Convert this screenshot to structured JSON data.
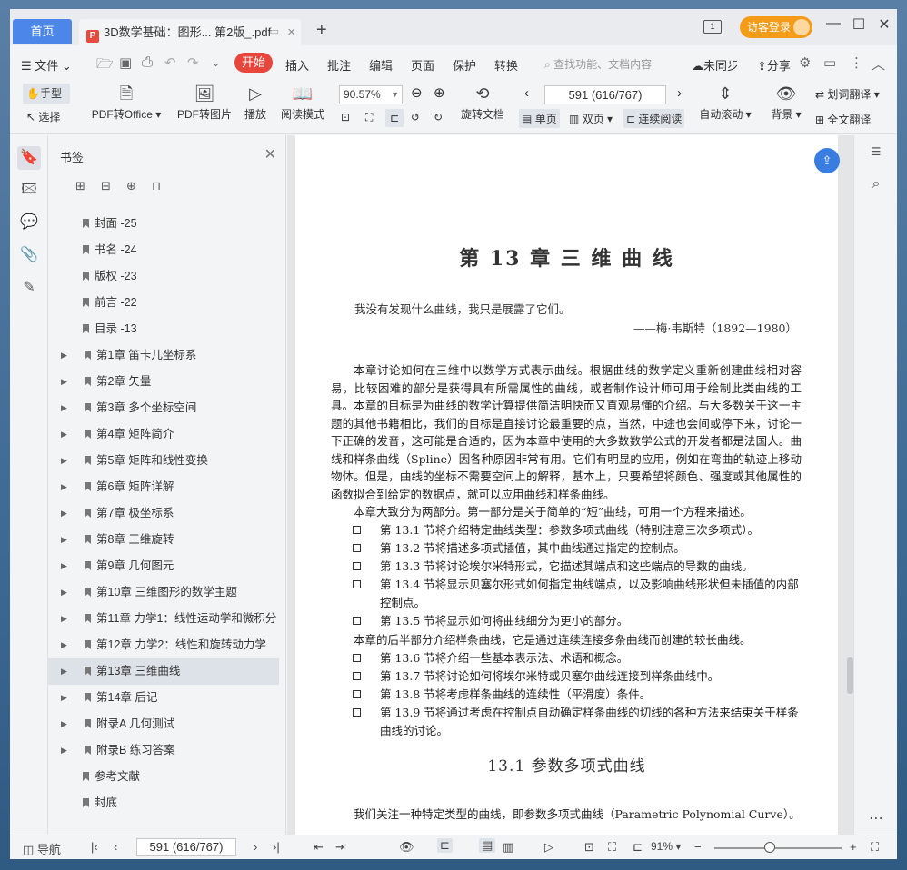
{
  "tabs": {
    "home": "首页",
    "doc_title": "3D数学基础：图形... 第2版_.pdf"
  },
  "titlebar": {
    "login": "访客登录"
  },
  "menu": {
    "file": "文件",
    "start": "开始",
    "items": [
      "插入",
      "批注",
      "编辑",
      "页面",
      "保护",
      "转换"
    ],
    "search_placeholder": "查找功能、文档内容",
    "sync": "未同步",
    "share": "分享"
  },
  "ribbon": {
    "hand": "手型",
    "select": "选择",
    "pdf_to_office": "PDF转Office",
    "pdf_to_image": "PDF转图片",
    "play": "播放",
    "read_mode": "阅读模式",
    "zoom": "90.57%",
    "rotate_doc": "旋转文档",
    "page_value": "591 (616/767)",
    "single": "单页",
    "double": "双页",
    "continuous": "连续阅读",
    "autoscroll": "自动滚动",
    "background": "背景",
    "word_translate": "划词翻译",
    "full_translate": "全文翻译"
  },
  "bookmarks": {
    "title": "书签",
    "items": [
      {
        "label": "封面 -25",
        "expandable": false
      },
      {
        "label": "书名 -24",
        "expandable": false
      },
      {
        "label": "版权 -23",
        "expandable": false
      },
      {
        "label": "前言 -22",
        "expandable": false
      },
      {
        "label": "目录 -13",
        "expandable": false
      },
      {
        "label": "第1章 笛卡儿坐标系",
        "expandable": true
      },
      {
        "label": "第2章 矢量",
        "expandable": true
      },
      {
        "label": "第3章 多个坐标空间",
        "expandable": true
      },
      {
        "label": "第4章 矩阵简介",
        "expandable": true
      },
      {
        "label": "第5章 矩阵和线性变换",
        "expandable": true
      },
      {
        "label": "第6章 矩阵详解",
        "expandable": true
      },
      {
        "label": "第7章 极坐标系",
        "expandable": true
      },
      {
        "label": "第8章 三维旋转",
        "expandable": true
      },
      {
        "label": "第9章 几何图元",
        "expandable": true
      },
      {
        "label": "第10章 三维图形的数学主题",
        "expandable": true
      },
      {
        "label": "第11章 力学1：线性运动学和微积分",
        "expandable": true
      },
      {
        "label": "第12章 力学2：线性和旋转动力学",
        "expandable": true
      },
      {
        "label": "第13章 三维曲线",
        "expandable": true,
        "selected": true
      },
      {
        "label": "第14章 后记",
        "expandable": true
      },
      {
        "label": "附录A 几何测试",
        "expandable": true
      },
      {
        "label": "附录B 练习答案",
        "expandable": true
      },
      {
        "label": "参考文献",
        "expandable": false
      },
      {
        "label": "封底",
        "expandable": false
      }
    ]
  },
  "page": {
    "chapter_title": "第 13 章   三 维 曲 线",
    "quote": "我没有发现什么曲线，我只是展露了它们。",
    "quote_author": "——梅·韦斯特（1892—1980）",
    "para1": "本章讨论如何在三维中以数学方式表示曲线。根据曲线的数学定义重新创建曲线相对容易，比较困难的部分是获得具有所需属性的曲线，或者制作设计师可用于绘制此类曲线的工具。本章的目标是为曲线的数学计算提供简洁明快而又直观易懂的介绍。与大多数关于这一主题的其他书籍相比，我们的目标是直接讨论最重要的点，当然，中途也会间或停下来，讨论一下正确的发音，这可能是合适的，因为本章中使用的大多数数学公式的开发者都是法国人。曲线和样条曲线（Spline）因各种原因非常有用。它们有明显的应用，例如在弯曲的轨迹上移动物体。但是，曲线的坐标不需要空间上的解释，基本上，只要希望将颜色、强度或其他属性的函数拟合到给定的数据点，就可以应用曲线和样条曲线。",
    "para2": "本章大致分为两部分。第一部分是关于简单的“短”曲线，可用一个方程来描述。",
    "list1": [
      "第 13.1 节将介绍特定曲线类型：参数多项式曲线（特别注意三次多项式）。",
      "第 13.2 节将描述多项式插值，其中曲线通过指定的控制点。",
      "第 13.3 节将讨论埃尔米特形式，它描述其端点和这些端点的导数的曲线。",
      "第 13.4 节将显示贝塞尔形式如何指定曲线端点，以及影响曲线形状但未插值的内部控制点。",
      "第 13.5 节将显示如何将曲线细分为更小的部分。"
    ],
    "para3": "本章的后半部分介绍样条曲线，它是通过连续连接多条曲线而创建的较长曲线。",
    "list2": [
      "第 13.6 节将介绍一些基本表示法、术语和概念。",
      "第 13.7 节将讨论如何将埃尔米特或贝塞尔曲线连接到样条曲线中。",
      "第 13.8 节将考虑样条曲线的连续性（平滑度）条件。",
      "第 13.9 节将通过考虑在控制点自动确定样条曲线的切线的各种方法来结束关于样条曲线的讨论。"
    ],
    "section_title": "13.1   参数多项式曲线",
    "para4": "我们关注一种特定类型的曲线，即参数多项式曲线（Parametric Polynomial Curve）。"
  },
  "statusbar": {
    "nav": "导航",
    "page_value": "591 (616/767)",
    "zoom": "91%"
  }
}
